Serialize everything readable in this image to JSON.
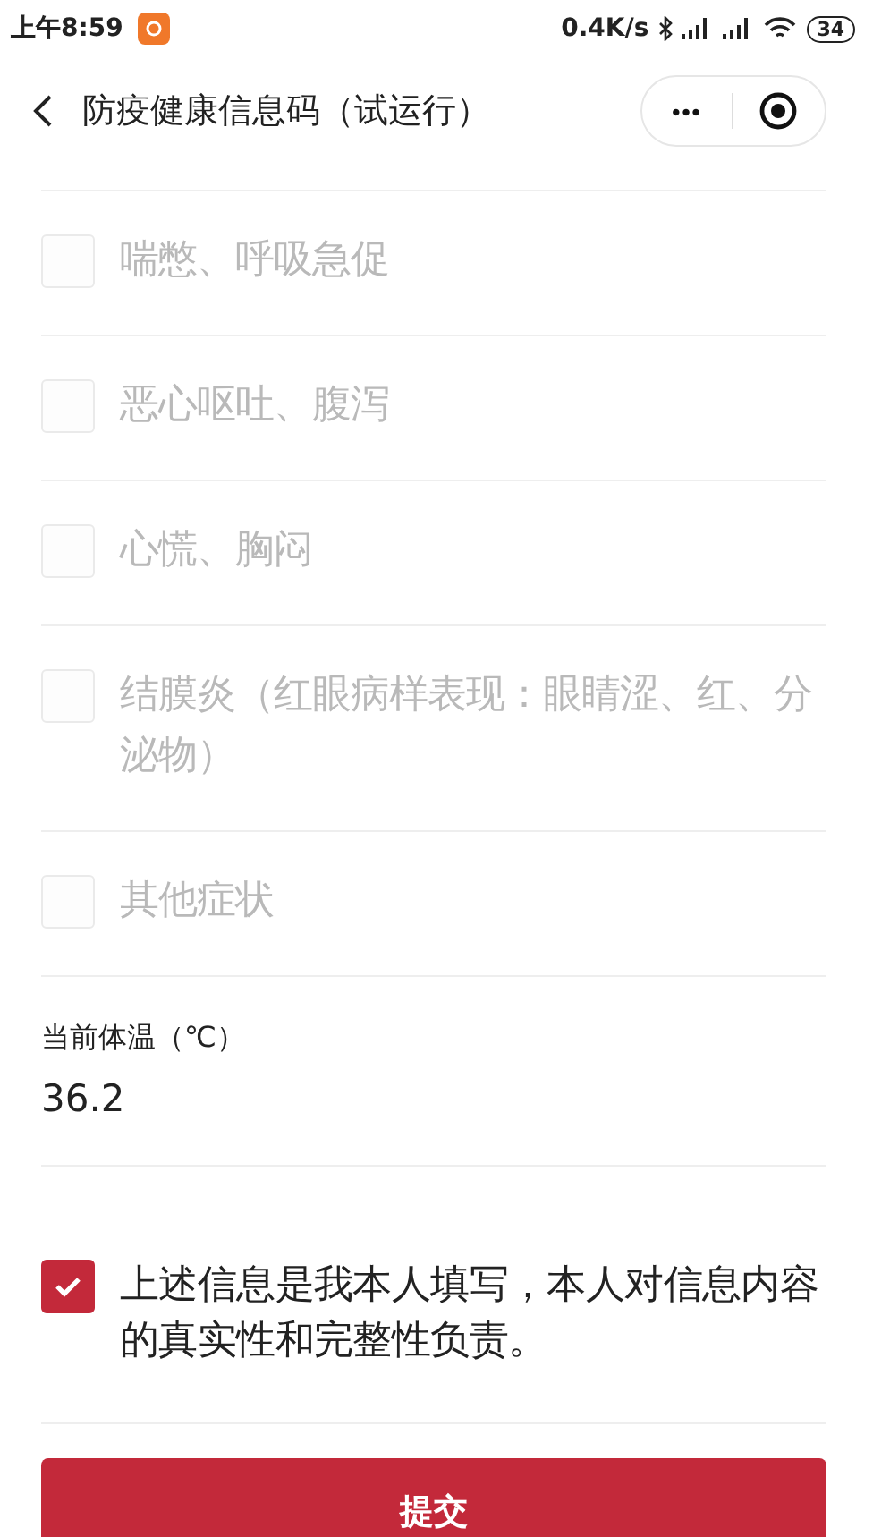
{
  "status_bar": {
    "time": "上午8:59",
    "speed": "0.4K/s",
    "battery": "34"
  },
  "nav": {
    "title": "防疫健康信息码（试运行）",
    "more": "•••"
  },
  "symptoms": [
    {
      "label": "喘憋、呼吸急促",
      "checked": false,
      "disabled": true
    },
    {
      "label": "恶心呕吐、腹泻",
      "checked": false,
      "disabled": true
    },
    {
      "label": "心慌、胸闷",
      "checked": false,
      "disabled": true
    },
    {
      "label": "结膜炎（红眼病样表现：眼睛涩、红、分泌物）",
      "checked": false,
      "disabled": true
    },
    {
      "label": "其他症状",
      "checked": false,
      "disabled": true
    }
  ],
  "temperature": {
    "label": "当前体温（℃）",
    "value": "36.2"
  },
  "agreement": {
    "text": "上述信息是我本人填写，本人对信息内容的真实性和完整性负责。",
    "checked": true
  },
  "submit": {
    "label": "提交"
  }
}
